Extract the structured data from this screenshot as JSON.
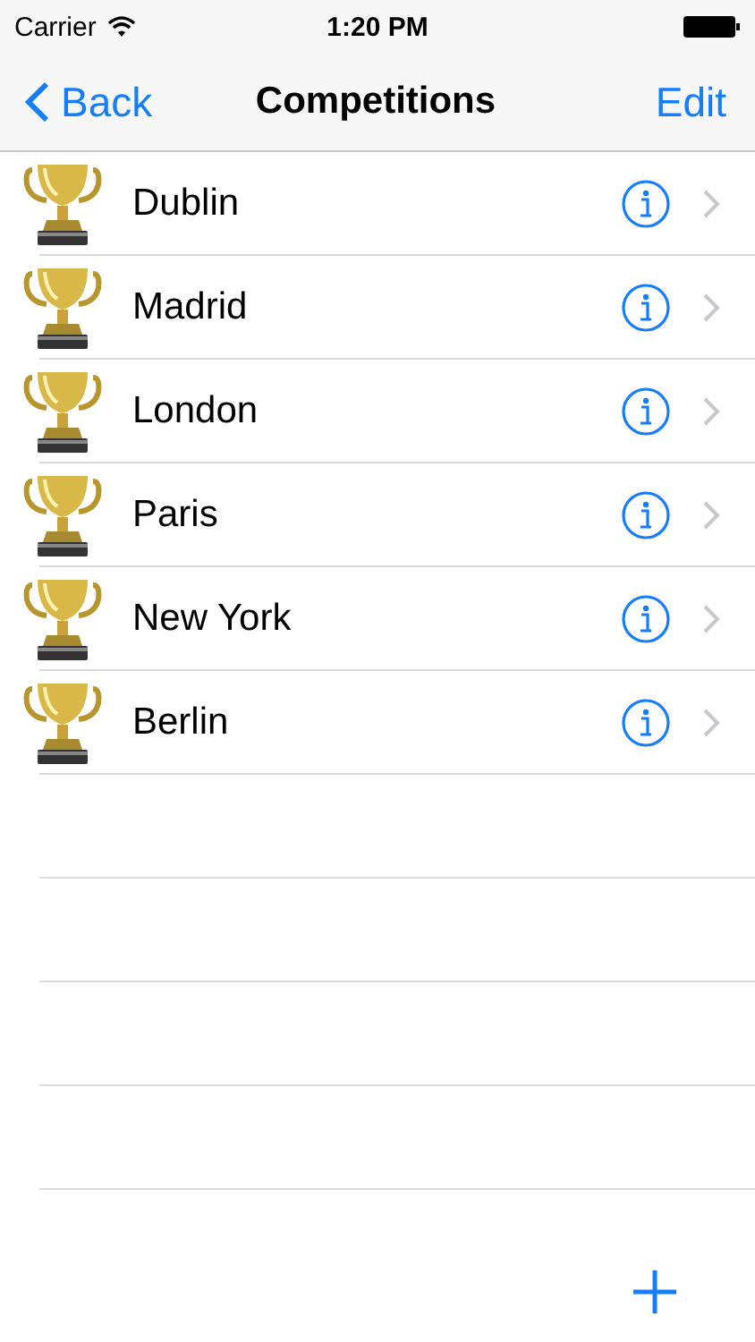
{
  "status_bar": {
    "carrier": "Carrier",
    "time": "1:20 PM"
  },
  "nav_bar": {
    "back": "Back",
    "title": "Competitions",
    "action": "Edit"
  },
  "competitions": [
    {
      "name": "Dublin"
    },
    {
      "name": "Madrid"
    },
    {
      "name": "London"
    },
    {
      "name": "Paris"
    },
    {
      "name": "New York"
    },
    {
      "name": "Berlin"
    }
  ]
}
